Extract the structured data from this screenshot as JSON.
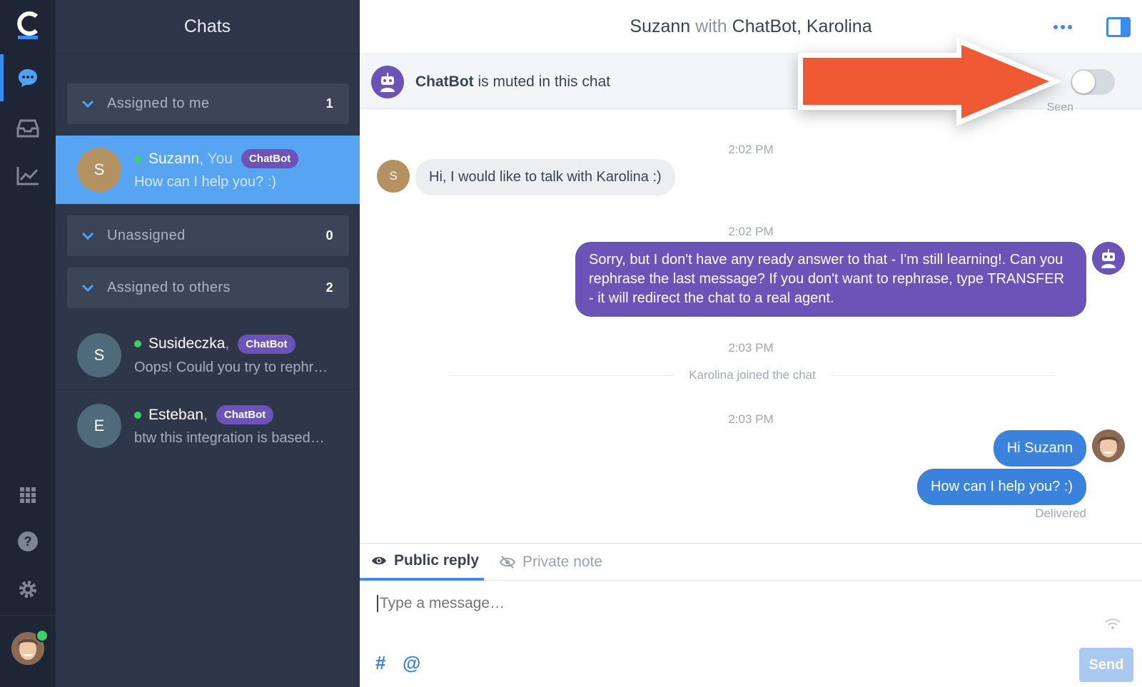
{
  "rail": {
    "items": [
      "chats",
      "inbox",
      "reports"
    ],
    "bottom": [
      "apps",
      "help",
      "settings"
    ]
  },
  "list": {
    "title": "Chats",
    "groups": [
      {
        "label": "Assigned to me",
        "count": "1"
      },
      {
        "label": "Unassigned",
        "count": "0"
      },
      {
        "label": "Assigned to others",
        "count": "2"
      }
    ],
    "chats": [
      {
        "initial": "S",
        "name": "Suzann",
        "suffix": ", You",
        "badge": "ChatBot",
        "preview": "How can I help you? :)",
        "avatar_color": "#b39160"
      },
      {
        "initial": "S",
        "name": "Susideczka",
        "suffix": ",",
        "badge": "ChatBot",
        "preview": "Oops! Could you try to rephr…",
        "avatar_color": "#4f6a7a"
      },
      {
        "initial": "E",
        "name": "Esteban",
        "suffix": ",",
        "badge": "ChatBot",
        "preview": "btw this integration is based…",
        "avatar_color": "#4f6a7a"
      }
    ]
  },
  "conversation": {
    "header": {
      "customer": "Suzann",
      "with": "with",
      "agents": "ChatBot, Karolina"
    },
    "banner": {
      "bot": "ChatBot",
      "text": " is muted in this chat",
      "toggle_on": false
    },
    "seen": "Seen",
    "messages": [
      {
        "time": "2:02 PM",
        "initial": "S",
        "text": "Hi, I would like to talk with Karolina :)"
      },
      {
        "time": "2:02 PM",
        "text": "Sorry, but I don't have any ready answer to that - I'm still learning!. Can you rephrase the last message? If you don't want to rephrase, type TRANSFER - it will redirect the chat to a real agent."
      },
      {
        "time": "2:03 PM",
        "event": "Karolina joined the chat"
      },
      {
        "time": "2:03 PM",
        "texts": [
          "Hi Suzann",
          "How can I help you? :)"
        ],
        "status": "Delivered"
      }
    ]
  },
  "composer": {
    "tab_public": "Public reply",
    "tab_private": "Private note",
    "placeholder": "Type a message…",
    "hash": "#",
    "at": "@",
    "send": "Send"
  },
  "colors": {
    "accent": "#3a8cf0",
    "bot": "#6b53b8",
    "agent_bubble": "#3b82dc",
    "online": "#3ccf6b",
    "annotation_arrow": "#ef5a35"
  }
}
